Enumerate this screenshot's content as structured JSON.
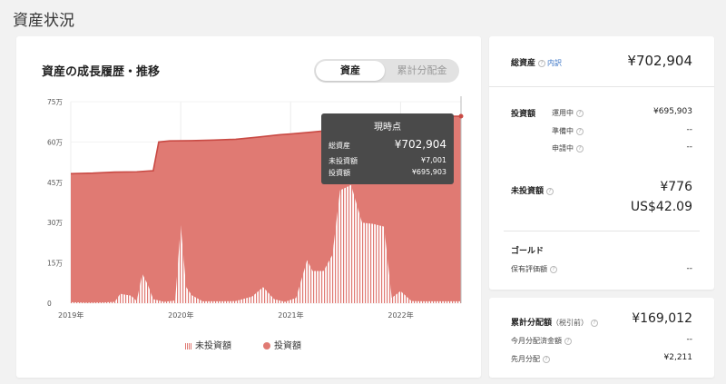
{
  "page_title": "資産状況",
  "chart_section": {
    "title": "資産の成長履歴・推移",
    "toggle": {
      "active": "資産",
      "inactive": "累計分配金"
    },
    "legend": {
      "uninvested": "未投資額",
      "invested": "投資額"
    },
    "tooltip": {
      "title": "現時点",
      "rows": [
        {
          "label": "総資産",
          "value": "¥702,904"
        },
        {
          "label": "未投資額",
          "value": "¥7,001"
        },
        {
          "label": "投資額",
          "value": "¥695,903"
        }
      ]
    }
  },
  "chart_data": {
    "type": "area",
    "y_tick_labels": [
      "0",
      "15万",
      "30万",
      "45万",
      "60万",
      "75万"
    ],
    "y_ticks": [
      0,
      150000,
      300000,
      450000,
      600000,
      750000
    ],
    "ylim": [
      0,
      750000
    ],
    "x_tick_labels": [
      "2019年",
      "2020年",
      "2021年",
      "2022年"
    ],
    "x_ticks": [
      2019,
      2020,
      2021,
      2022
    ],
    "xlim": [
      2019,
      2022.55
    ],
    "colors": {
      "invested": "#e07a73",
      "line": "#c94a44",
      "uninvested_stripe": "#e07a73"
    },
    "series": [
      {
        "name": "投資額",
        "points": [
          [
            2019.0,
            482000
          ],
          [
            2019.2,
            484000
          ],
          [
            2019.4,
            488000
          ],
          [
            2019.6,
            489000
          ],
          [
            2019.7,
            492000
          ],
          [
            2019.75,
            493000
          ],
          [
            2019.8,
            600000
          ],
          [
            2019.9,
            604000
          ],
          [
            2020.1,
            605000
          ],
          [
            2020.3,
            607000
          ],
          [
            2020.5,
            610000
          ],
          [
            2020.7,
            618000
          ],
          [
            2020.9,
            627000
          ],
          [
            2021.0,
            630000
          ],
          [
            2021.2,
            637000
          ],
          [
            2021.4,
            645000
          ],
          [
            2021.6,
            656000
          ],
          [
            2021.7,
            657000
          ],
          [
            2021.8,
            658000
          ],
          [
            2021.9,
            665000
          ],
          [
            2022.1,
            677000
          ],
          [
            2022.3,
            690000
          ],
          [
            2022.45,
            695903
          ],
          [
            2022.55,
            695903
          ]
        ]
      },
      {
        "name": "未投資額",
        "points": [
          [
            2019.0,
            4000
          ],
          [
            2019.15,
            2000
          ],
          [
            2019.3,
            3000
          ],
          [
            2019.4,
            5000
          ],
          [
            2019.45,
            35000
          ],
          [
            2019.55,
            28000
          ],
          [
            2019.6,
            8000
          ],
          [
            2019.65,
            110000
          ],
          [
            2019.7,
            70000
          ],
          [
            2019.75,
            15000
          ],
          [
            2019.85,
            5000
          ],
          [
            2019.95,
            10000
          ],
          [
            2020.0,
            290000
          ],
          [
            2020.05,
            60000
          ],
          [
            2020.1,
            30000
          ],
          [
            2020.2,
            7000
          ],
          [
            2020.4,
            7000
          ],
          [
            2020.5,
            8000
          ],
          [
            2020.65,
            25000
          ],
          [
            2020.75,
            60000
          ],
          [
            2020.85,
            15000
          ],
          [
            2020.95,
            5000
          ],
          [
            2021.05,
            20000
          ],
          [
            2021.15,
            160000
          ],
          [
            2021.2,
            120000
          ],
          [
            2021.3,
            120000
          ],
          [
            2021.38,
            180000
          ],
          [
            2021.45,
            420000
          ],
          [
            2021.55,
            440000
          ],
          [
            2021.65,
            300000
          ],
          [
            2021.75,
            295000
          ],
          [
            2021.85,
            285000
          ],
          [
            2021.92,
            20000
          ],
          [
            2022.0,
            45000
          ],
          [
            2022.1,
            8000
          ],
          [
            2022.2,
            7001
          ],
          [
            2022.55,
            7001
          ]
        ]
      }
    ]
  },
  "summary_card": {
    "total_assets": {
      "label": "総資産",
      "link": "内訳",
      "value": "¥702,904"
    },
    "invested": {
      "label": "投資額",
      "rows": [
        {
          "label": "運用中",
          "value": "¥695,903"
        },
        {
          "label": "準備中",
          "value": "--"
        },
        {
          "label": "申請中",
          "value": "--"
        }
      ]
    },
    "uninvested": {
      "label": "未投資額",
      "value_jpy": "¥776",
      "value_usd": "US$42.09"
    },
    "gold": {
      "label": "ゴールド",
      "sub_label": "保有評価額",
      "value": "--"
    }
  },
  "dividend_card": {
    "label": "累計分配額",
    "note": "（税引前）",
    "value": "¥169,012",
    "rows": [
      {
        "label": "今月分配済金額",
        "value": "--"
      },
      {
        "label": "先月分配",
        "value": "¥2,211"
      }
    ]
  },
  "help_icon": "?"
}
